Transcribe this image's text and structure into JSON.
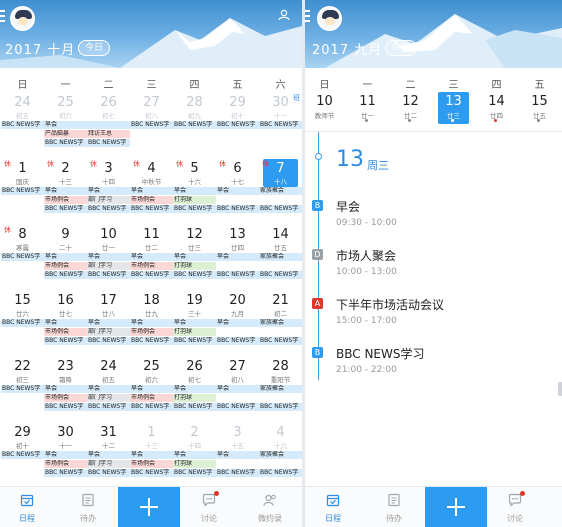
{
  "left": {
    "header": {
      "title": "2017 十月",
      "today_label": "今日"
    },
    "weekdays": [
      "日",
      "一",
      "二",
      "三",
      "四",
      "五",
      "六"
    ],
    "weeks": [
      [
        {
          "day": "24",
          "sub": "初五",
          "other": true,
          "events": [
            {
              "t": "BBC NEWS学",
              "c": "blue"
            }
          ]
        },
        {
          "day": "25",
          "sub": "初六",
          "other": true,
          "events": [
            {
              "t": "早会",
              "c": "blue"
            },
            {
              "t": "产品脑暴",
              "c": "red"
            },
            {
              "t": "BBC NEWS学",
              "c": "blue"
            }
          ]
        },
        {
          "day": "26",
          "sub": "初七",
          "other": true,
          "events": [
            {
              "t": "",
              "c": "blue"
            },
            {
              "t": "拜访王总",
              "c": "red"
            },
            {
              "t": "BBC NEWS学",
              "c": "blue"
            }
          ]
        },
        {
          "day": "27",
          "sub": "初八",
          "other": true,
          "events": [
            {
              "t": "BBC NEWS学",
              "c": "blue"
            }
          ]
        },
        {
          "day": "28",
          "sub": "初九",
          "other": true,
          "events": [
            {
              "t": "BBC NEWS学",
              "c": "blue"
            }
          ]
        },
        {
          "day": "29",
          "sub": "初十",
          "other": true,
          "events": [
            {
              "t": "BBC NEWS学",
              "c": "blue"
            }
          ]
        },
        {
          "day": "30",
          "sub": "十一",
          "other": true,
          "ban": "班",
          "events": [
            {
              "t": "BBC NEWS学",
              "c": "blue"
            }
          ]
        }
      ],
      [
        {
          "day": "1",
          "sub": "国庆",
          "xiu": "休",
          "events": [
            {
              "t": "BBC NEWS学",
              "c": "blue"
            }
          ]
        },
        {
          "day": "2",
          "sub": "十三",
          "xiu": "休",
          "events": [
            {
              "t": "早会",
              "c": "blue"
            },
            {
              "t": "市场例会",
              "c": "red"
            },
            {
              "t": "BBC NEWS学",
              "c": "blue"
            }
          ]
        },
        {
          "day": "3",
          "sub": "十四",
          "xiu": "休",
          "events": [
            {
              "t": "早会",
              "c": "blue"
            },
            {
              "t": "部门学习",
              "c": "gray"
            },
            {
              "t": "BBC NEWS学",
              "c": "blue"
            }
          ]
        },
        {
          "day": "4",
          "sub": "中秋节",
          "xiu": "休",
          "events": [
            {
              "t": "早会",
              "c": "blue"
            },
            {
              "t": "市场例会",
              "c": "red"
            },
            {
              "t": "BBC NEWS学",
              "c": "blue"
            }
          ]
        },
        {
          "day": "5",
          "sub": "十六",
          "xiu": "休",
          "events": [
            {
              "t": "早会",
              "c": "blue"
            },
            {
              "t": "打羽球",
              "c": "green"
            },
            {
              "t": "BBC NEWS学",
              "c": "blue"
            }
          ]
        },
        {
          "day": "6",
          "sub": "十七",
          "xiu": "休",
          "events": [
            {
              "t": "早会",
              "c": "blue"
            },
            {
              "t": "",
              "c": "empty"
            },
            {
              "t": "BBC NEWS学",
              "c": "blue"
            }
          ]
        },
        {
          "day": "7",
          "sub": "十八",
          "xiu": "休",
          "selected": true,
          "events": [
            {
              "t": "家族聚会",
              "c": "blue"
            },
            {
              "t": "",
              "c": "empty"
            },
            {
              "t": "BBC NEWS学",
              "c": "blue"
            }
          ]
        }
      ],
      [
        {
          "day": "8",
          "sub": "寒露",
          "xiu": "休",
          "events": [
            {
              "t": "BBC NEWS学",
              "c": "blue"
            }
          ]
        },
        {
          "day": "9",
          "sub": "二十",
          "events": [
            {
              "t": "早会",
              "c": "blue"
            },
            {
              "t": "市场例会",
              "c": "red"
            },
            {
              "t": "BBC NEWS学",
              "c": "blue"
            }
          ]
        },
        {
          "day": "10",
          "sub": "廿一",
          "events": [
            {
              "t": "早会",
              "c": "blue"
            },
            {
              "t": "部门学习",
              "c": "gray"
            },
            {
              "t": "BBC NEWS学",
              "c": "blue"
            }
          ]
        },
        {
          "day": "11",
          "sub": "廿二",
          "events": [
            {
              "t": "早会",
              "c": "blue"
            },
            {
              "t": "市场例会",
              "c": "red"
            },
            {
              "t": "BBC NEWS学",
              "c": "blue"
            }
          ]
        },
        {
          "day": "12",
          "sub": "廿三",
          "events": [
            {
              "t": "早会",
              "c": "blue"
            },
            {
              "t": "打羽球",
              "c": "green"
            },
            {
              "t": "BBC NEWS学",
              "c": "blue"
            }
          ]
        },
        {
          "day": "13",
          "sub": "廿四",
          "events": [
            {
              "t": "早会",
              "c": "blue"
            },
            {
              "t": "",
              "c": "empty"
            },
            {
              "t": "BBC NEWS学",
              "c": "blue"
            }
          ]
        },
        {
          "day": "14",
          "sub": "廿五",
          "events": [
            {
              "t": "家族聚会",
              "c": "blue"
            },
            {
              "t": "",
              "c": "empty"
            },
            {
              "t": "BBC NEWS学",
              "c": "blue"
            }
          ]
        }
      ],
      [
        {
          "day": "15",
          "sub": "廿六",
          "events": [
            {
              "t": "BBC NEWS学",
              "c": "blue"
            }
          ]
        },
        {
          "day": "16",
          "sub": "廿七",
          "events": [
            {
              "t": "早会",
              "c": "blue"
            },
            {
              "t": "市场例会",
              "c": "red"
            },
            {
              "t": "BBC NEWS学",
              "c": "blue"
            }
          ]
        },
        {
          "day": "17",
          "sub": "廿八",
          "events": [
            {
              "t": "早会",
              "c": "blue"
            },
            {
              "t": "部门学习",
              "c": "gray"
            },
            {
              "t": "BBC NEWS学",
              "c": "blue"
            }
          ]
        },
        {
          "day": "18",
          "sub": "廿九",
          "events": [
            {
              "t": "早会",
              "c": "blue"
            },
            {
              "t": "市场例会",
              "c": "red"
            },
            {
              "t": "BBC NEWS学",
              "c": "blue"
            }
          ]
        },
        {
          "day": "19",
          "sub": "三十",
          "events": [
            {
              "t": "早会",
              "c": "blue"
            },
            {
              "t": "打羽球",
              "c": "green"
            },
            {
              "t": "BBC NEWS学",
              "c": "blue"
            }
          ]
        },
        {
          "day": "20",
          "sub": "九月",
          "events": [
            {
              "t": "早会",
              "c": "blue"
            },
            {
              "t": "",
              "c": "empty"
            },
            {
              "t": "BBC NEWS学",
              "c": "blue"
            }
          ]
        },
        {
          "day": "21",
          "sub": "初二",
          "events": [
            {
              "t": "家族聚会",
              "c": "blue"
            },
            {
              "t": "",
              "c": "empty"
            },
            {
              "t": "BBC NEWS学",
              "c": "blue"
            }
          ]
        }
      ],
      [
        {
          "day": "22",
          "sub": "初三",
          "events": [
            {
              "t": "BBC NEWS学",
              "c": "blue"
            }
          ]
        },
        {
          "day": "23",
          "sub": "霜降",
          "events": [
            {
              "t": "早会",
              "c": "blue"
            },
            {
              "t": "市场例会",
              "c": "red"
            },
            {
              "t": "BBC NEWS学",
              "c": "blue"
            }
          ]
        },
        {
          "day": "24",
          "sub": "初五",
          "events": [
            {
              "t": "早会",
              "c": "blue"
            },
            {
              "t": "部门学习",
              "c": "gray"
            },
            {
              "t": "BBC NEWS学",
              "c": "blue"
            }
          ]
        },
        {
          "day": "25",
          "sub": "初六",
          "events": [
            {
              "t": "早会",
              "c": "blue"
            },
            {
              "t": "市场例会",
              "c": "red"
            },
            {
              "t": "BBC NEWS学",
              "c": "blue"
            }
          ]
        },
        {
          "day": "26",
          "sub": "初七",
          "events": [
            {
              "t": "早会",
              "c": "blue"
            },
            {
              "t": "打羽球",
              "c": "green"
            },
            {
              "t": "BBC NEWS学",
              "c": "blue"
            }
          ]
        },
        {
          "day": "27",
          "sub": "初八",
          "events": [
            {
              "t": "早会",
              "c": "blue"
            },
            {
              "t": "",
              "c": "empty"
            },
            {
              "t": "BBC NEWS学",
              "c": "blue"
            }
          ]
        },
        {
          "day": "28",
          "sub": "重阳节",
          "events": [
            {
              "t": "家族聚会",
              "c": "blue"
            },
            {
              "t": "",
              "c": "empty"
            },
            {
              "t": "BBC NEWS学",
              "c": "blue"
            }
          ]
        }
      ],
      [
        {
          "day": "29",
          "sub": "初十",
          "events": [
            {
              "t": "BBC NEWS学",
              "c": "blue"
            }
          ]
        },
        {
          "day": "30",
          "sub": "十一",
          "events": [
            {
              "t": "早会",
              "c": "blue"
            },
            {
              "t": "市场例会",
              "c": "red"
            },
            {
              "t": "BBC NEWS学",
              "c": "blue"
            }
          ]
        },
        {
          "day": "31",
          "sub": "十二",
          "events": [
            {
              "t": "早会",
              "c": "blue"
            },
            {
              "t": "部门学习",
              "c": "gray"
            },
            {
              "t": "BBC NEWS学",
              "c": "blue"
            }
          ]
        },
        {
          "day": "1",
          "sub": "十三",
          "other": true,
          "events": [
            {
              "t": "早会",
              "c": "blue"
            },
            {
              "t": "市场例会",
              "c": "red"
            },
            {
              "t": "BBC NEWS学",
              "c": "blue"
            }
          ]
        },
        {
          "day": "2",
          "sub": "十四",
          "other": true,
          "events": [
            {
              "t": "早会",
              "c": "blue"
            },
            {
              "t": "打羽球",
              "c": "green"
            },
            {
              "t": "BBC NEWS学",
              "c": "blue"
            }
          ]
        },
        {
          "day": "3",
          "sub": "十五",
          "other": true,
          "events": [
            {
              "t": "早会",
              "c": "blue"
            },
            {
              "t": "",
              "c": "empty"
            },
            {
              "t": "BBC NEWS学",
              "c": "blue"
            }
          ]
        },
        {
          "day": "4",
          "sub": "十六",
          "other": true,
          "events": [
            {
              "t": "家族聚会",
              "c": "blue"
            },
            {
              "t": "",
              "c": "empty"
            },
            {
              "t": "BBC NEWS学",
              "c": "blue"
            }
          ]
        }
      ]
    ],
    "tabs": [
      {
        "label": "日程",
        "icon": "calendar-icon",
        "active": true
      },
      {
        "label": "待办",
        "icon": "todo-list-icon"
      },
      {
        "label": "讨论",
        "icon": "chat-bubble-icon",
        "badge": true
      },
      {
        "label": "微约录",
        "icon": "contacts-icon"
      }
    ]
  },
  "right": {
    "header": {
      "title": "2017 九月",
      "today_label": "今日"
    },
    "weekdays": [
      "日",
      "一",
      "二",
      "三",
      "四",
      "五"
    ],
    "days": [
      {
        "day": "10",
        "sub": "教师节",
        "dot": false
      },
      {
        "day": "11",
        "sub": "廿一",
        "dot": true
      },
      {
        "day": "12",
        "sub": "廿二",
        "dot": true
      },
      {
        "day": "13",
        "sub": "廿三",
        "dot": true,
        "selected": true
      },
      {
        "day": "14",
        "sub": "廿四",
        "dot": true,
        "dot_color": "#e0362c"
      },
      {
        "day": "15",
        "sub": "廿五",
        "dot": true
      }
    ],
    "selected_day": {
      "number": "13",
      "weekday": "周三"
    },
    "events": [
      {
        "badge": "B",
        "color": "#2d9cf0",
        "title": "早会",
        "time": "09:30 - 10:00"
      },
      {
        "badge": "D",
        "color": "#9aa0a8",
        "title": "市场人聚会",
        "time": "10:00 - 13:00"
      },
      {
        "badge": "A",
        "color": "#e0362c",
        "title": "下半年市场活动会议",
        "time": "15:00 - 17:00"
      },
      {
        "badge": "B",
        "color": "#2d9cf0",
        "title": "BBC NEWS学习",
        "time": "21:00 - 22:00"
      }
    ],
    "tabs": [
      {
        "label": "日程",
        "icon": "calendar-icon",
        "active": true
      },
      {
        "label": "待办",
        "icon": "todo-list-icon"
      },
      {
        "label": "讨论",
        "icon": "chat-bubble-icon",
        "badge": true
      }
    ]
  }
}
